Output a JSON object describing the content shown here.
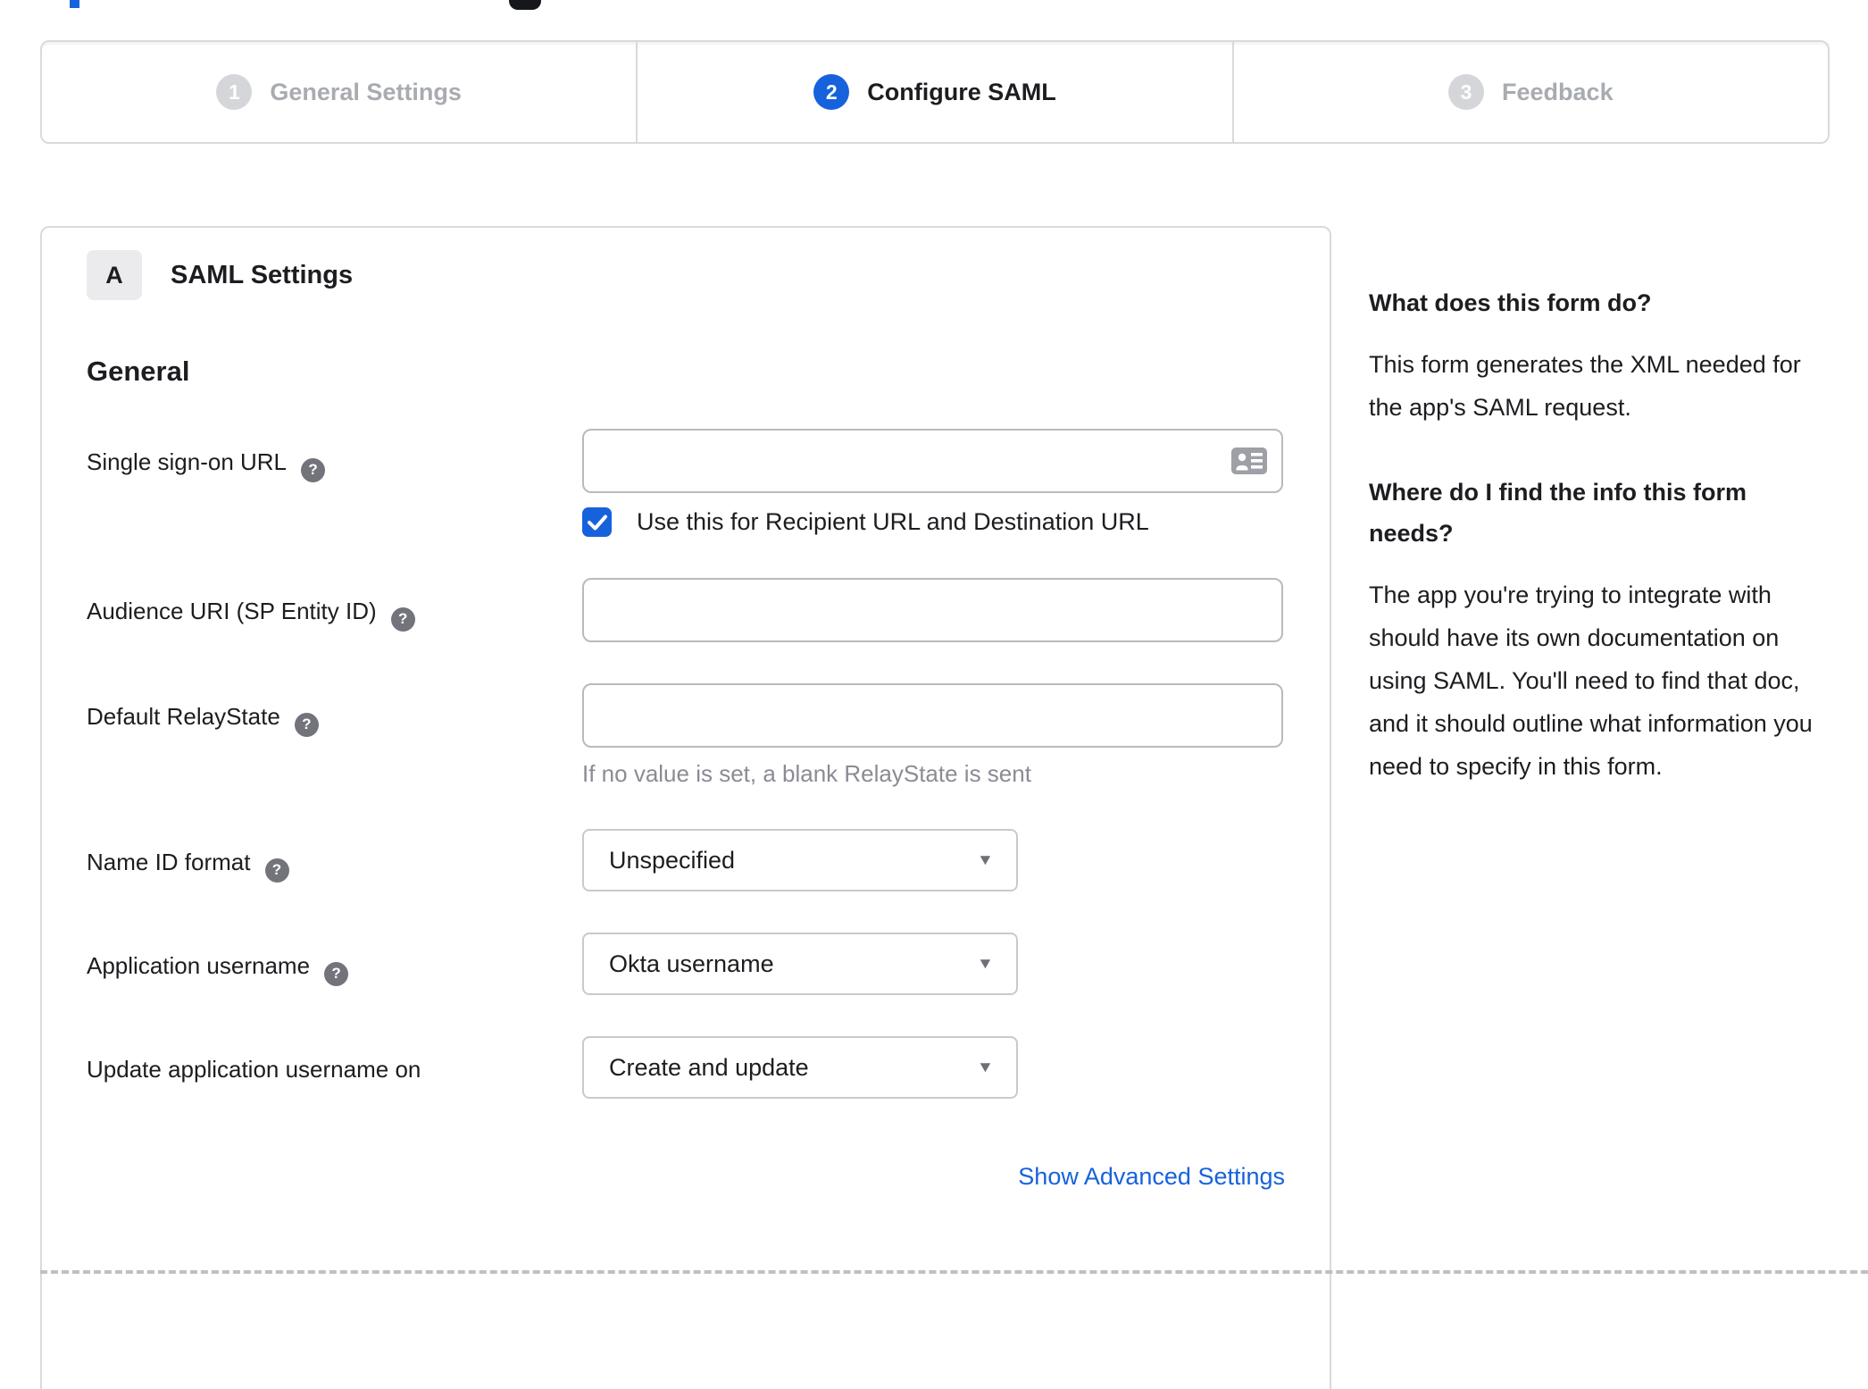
{
  "colors": {
    "accent_blue": "#1662dd",
    "text_dark": "#1d1d21",
    "inactive_gray": "#a8abb0",
    "border_gray": "#d9dadd",
    "hint_gray": "#8a8b94"
  },
  "stepper": {
    "steps": [
      {
        "number": "1",
        "label": "General Settings",
        "active": false
      },
      {
        "number": "2",
        "label": "Configure SAML",
        "active": true
      },
      {
        "number": "3",
        "label": "Feedback",
        "active": false
      }
    ]
  },
  "panel": {
    "badge": "A",
    "title": "SAML Settings",
    "section": "General",
    "fields": {
      "sso": {
        "label": "Single sign-on URL",
        "value": "",
        "checkbox": {
          "checked": true,
          "label": "Use this for Recipient URL and Destination URL"
        }
      },
      "audience": {
        "label": "Audience URI (SP Entity ID)",
        "value": ""
      },
      "relay": {
        "label": "Default RelayState",
        "value": "",
        "hint": "If no value is set, a blank RelayState is sent"
      },
      "name_id": {
        "label": "Name ID format",
        "value": "Unspecified"
      },
      "app_username": {
        "label": "Application username",
        "value": "Okta username"
      },
      "update_username": {
        "label": "Update application username on",
        "value": "Create and update"
      }
    },
    "advanced_link": "Show Advanced Settings"
  },
  "sidebar": {
    "q1": "What does this form do?",
    "a1": "This form generates the XML needed for the app's SAML request.",
    "q2": "Where do I find the info this form needs?",
    "a2": "The app you're trying to integrate with should have its own documentation on using SAML. You'll need to find that doc, and it should outline what information you need to specify in this form."
  }
}
